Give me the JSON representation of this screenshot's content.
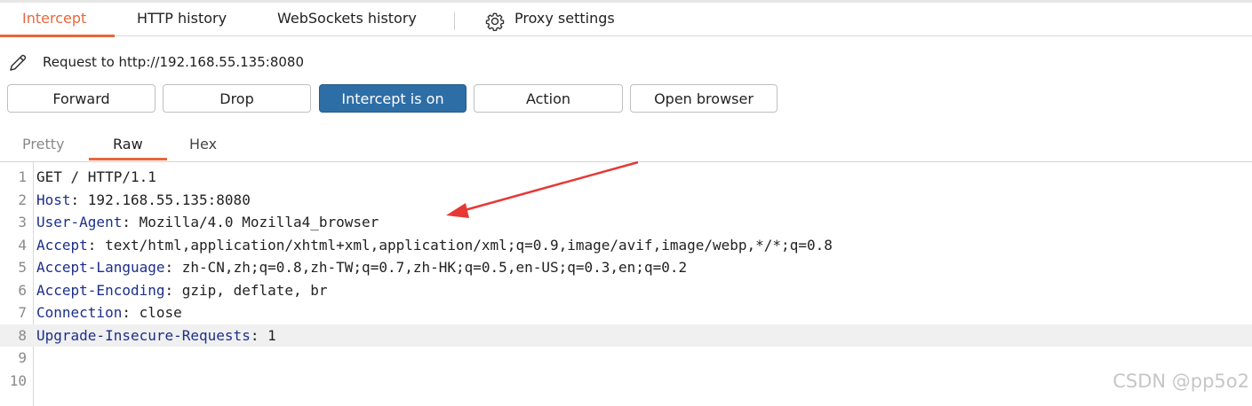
{
  "tabs": {
    "intercept": "Intercept",
    "http_history": "HTTP history",
    "websockets_history": "WebSockets history",
    "proxy_settings": "Proxy settings"
  },
  "request": {
    "label": "Request to http://192.168.55.135:8080"
  },
  "buttons": {
    "forward": "Forward",
    "drop": "Drop",
    "intercept": "Intercept is on",
    "action": "Action",
    "open_browser": "Open browser"
  },
  "view_tabs": {
    "pretty": "Pretty",
    "raw": "Raw",
    "hex": "Hex"
  },
  "lines": [
    {
      "num": "1",
      "name": "",
      "sep": "",
      "value": "GET / HTTP/1.1"
    },
    {
      "num": "2",
      "name": "Host",
      "sep": ": ",
      "value": "192.168.55.135:8080"
    },
    {
      "num": "3",
      "name": "User-Agent",
      "sep": ": ",
      "value": "Mozilla/4.0 Mozilla4_browser"
    },
    {
      "num": "4",
      "name": "Accept",
      "sep": ": ",
      "value": "text/html,application/xhtml+xml,application/xml;q=0.9,image/avif,image/webp,*/*;q=0.8"
    },
    {
      "num": "5",
      "name": "Accept-Language",
      "sep": ": ",
      "value": "zh-CN,zh;q=0.8,zh-TW;q=0.7,zh-HK;q=0.5,en-US;q=0.3,en;q=0.2"
    },
    {
      "num": "6",
      "name": "Accept-Encoding",
      "sep": ": ",
      "value": "gzip, deflate, br"
    },
    {
      "num": "7",
      "name": "Connection",
      "sep": ": ",
      "value": "close"
    },
    {
      "num": "8",
      "name": "Upgrade-Insecure-Requests",
      "sep": ": ",
      "value": "1"
    },
    {
      "num": "9",
      "name": "",
      "sep": "",
      "value": ""
    },
    {
      "num": "10",
      "name": "",
      "sep": "",
      "value": ""
    }
  ],
  "watermark": "CSDN @pp5o2",
  "colors": {
    "accent": "#e8673b",
    "intercept_on": "#2e6ea6",
    "header_name": "#1c2f8a",
    "annotation_arrow": "#e53935"
  },
  "icons": {
    "settings": "gear-icon",
    "request": "pencil-icon"
  }
}
